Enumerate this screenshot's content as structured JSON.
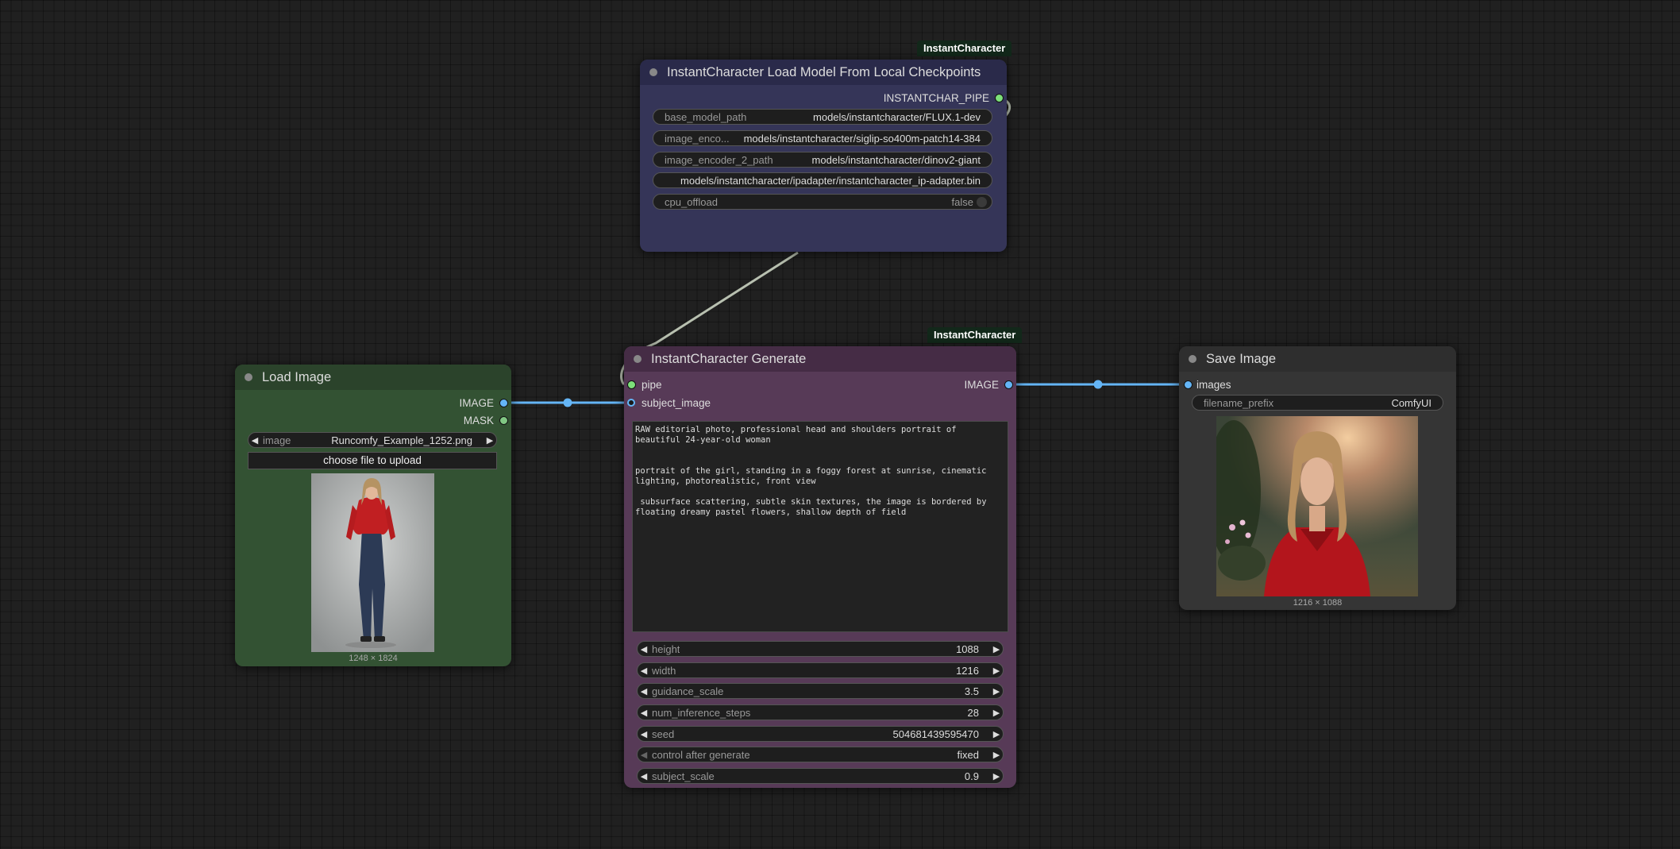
{
  "colors": {
    "link_image": "#64b5f6",
    "link_pipe": "#b8c0b0",
    "port_pipe": "#7de07a",
    "port_image": "#64b5f6",
    "port_mask": "#81c784"
  },
  "model_node": {
    "badge": "InstantCharacter",
    "title": "InstantCharacter Load Model From Local Checkpoints",
    "output_label": "INSTANTCHAR_PIPE",
    "widgets": [
      {
        "label": "base_model_path",
        "value": "models/instantcharacter/FLUX.1-dev"
      },
      {
        "label": "image_enco...",
        "value": "models/instantcharacter/siglip-so400m-patch14-384"
      },
      {
        "label": "image_encoder_2_path",
        "value": "models/instantcharacter/dinov2-giant"
      },
      {
        "label": "",
        "value": "models/instantcharacter/ipadapter/instantcharacter_ip-adapter.bin"
      },
      {
        "label": "cpu_offload",
        "value": "false"
      }
    ]
  },
  "load_node": {
    "title": "Load Image",
    "outputs": [
      "IMAGE",
      "MASK"
    ],
    "image_widget": {
      "label": "image",
      "value": "Runcomfy_Example_1252.png"
    },
    "upload_button": "choose file to upload",
    "preview_caption": "1248 × 1824"
  },
  "gen_node": {
    "badge": "InstantCharacter",
    "title": "InstantCharacter Generate",
    "inputs": [
      "pipe",
      "subject_image"
    ],
    "output_label": "IMAGE",
    "prompt": "RAW editorial photo, professional head and shoulders portrait of beautiful 24-year-old woman\n\n\nportrait of the girl, standing in a foggy forest at sunrise, cinematic lighting, photorealistic, front view\n\n subsurface scattering, subtle skin textures, the image is bordered by floating dreamy pastel flowers, shallow depth of field",
    "widgets": [
      {
        "label": "height",
        "value": "1088"
      },
      {
        "label": "width",
        "value": "1216"
      },
      {
        "label": "guidance_scale",
        "value": "3.5"
      },
      {
        "label": "num_inference_steps",
        "value": "28"
      },
      {
        "label": "seed",
        "value": "504681439595470"
      },
      {
        "label": "control after generate",
        "value": "fixed"
      },
      {
        "label": "subject_scale",
        "value": "0.9"
      }
    ]
  },
  "save_node": {
    "title": "Save Image",
    "input_label": "images",
    "widget": {
      "label": "filename_prefix",
      "value": "ComfyUI"
    },
    "preview_caption": "1216 × 1088"
  }
}
